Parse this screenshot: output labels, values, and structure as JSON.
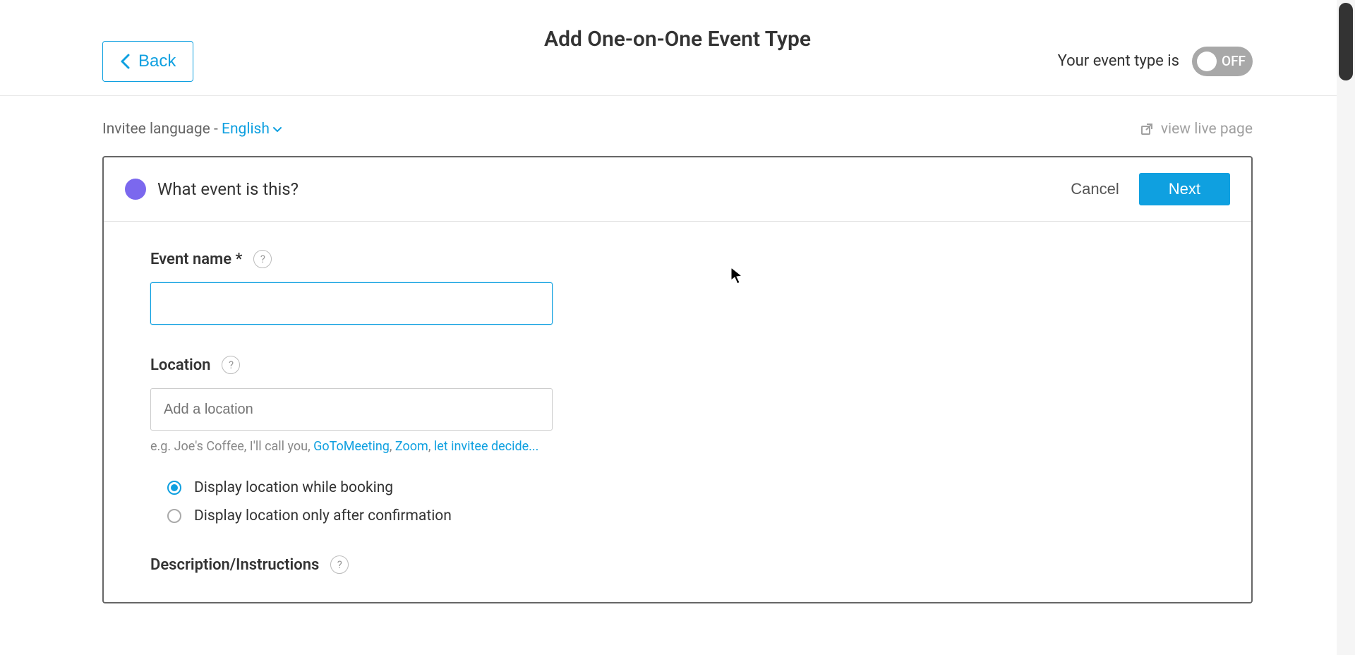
{
  "header": {
    "back_label": "Back",
    "page_title": "Add One-on-One Event Type",
    "toggle_prefix": "Your event type is",
    "toggle_state": "OFF"
  },
  "subbar": {
    "invitee_prefix": "Invitee language - ",
    "language": "English",
    "live_link": "view live page"
  },
  "section": {
    "heading": "What event is this?",
    "cancel": "Cancel",
    "next": "Next"
  },
  "form": {
    "event_name_label": "Event name *",
    "location_label": "Location",
    "location_placeholder": "Add a location",
    "location_hint_prefix": "e.g. Joe's Coffee, I'll call you, ",
    "location_link_gtm": "GoToMeeting",
    "location_link_zoom": "Zoom",
    "location_link_decide": "let invitee decide...",
    "radio_display_booking": "Display location while booking",
    "radio_display_confirm": "Display location only after confirmation",
    "description_label": "Description/Instructions"
  }
}
